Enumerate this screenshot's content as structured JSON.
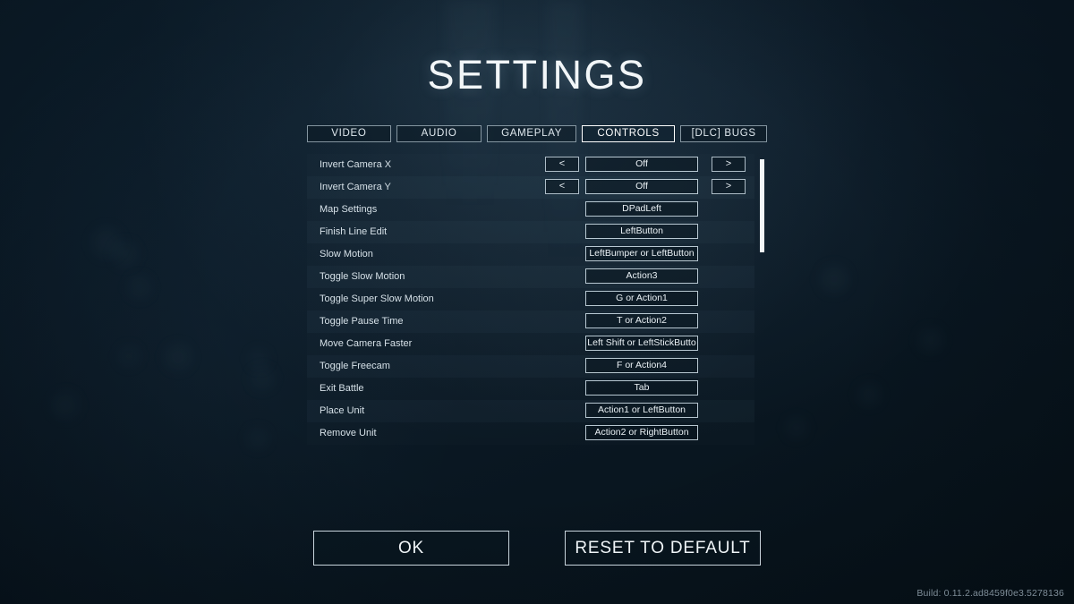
{
  "title": "SETTINGS",
  "tabs": [
    {
      "label": "VIDEO",
      "active": false
    },
    {
      "label": "AUDIO",
      "active": false
    },
    {
      "label": "GAMEPLAY",
      "active": false
    },
    {
      "label": "CONTROLS",
      "active": true
    },
    {
      "label": "[DLC] BUGS",
      "active": false
    }
  ],
  "settings": {
    "arrow_left_label": "<",
    "arrow_right_label": ">",
    "rows": [
      {
        "label": "Invert Camera X",
        "value": "Off",
        "arrows": true
      },
      {
        "label": "Invert Camera Y",
        "value": "Off",
        "arrows": true
      },
      {
        "label": "Map Settings",
        "value": "DPadLeft",
        "arrows": false
      },
      {
        "label": "Finish Line Edit",
        "value": "LeftButton",
        "arrows": false
      },
      {
        "label": "Slow Motion",
        "value": "LeftBumper or LeftButton",
        "arrows": false
      },
      {
        "label": "Toggle Slow Motion",
        "value": "Action3",
        "arrows": false
      },
      {
        "label": "Toggle Super Slow Motion",
        "value": "G or Action1",
        "arrows": false
      },
      {
        "label": "Toggle Pause Time",
        "value": "T or Action2",
        "arrows": false
      },
      {
        "label": "Move Camera Faster",
        "value": "Left Shift or LeftStickButto",
        "arrows": false
      },
      {
        "label": "Toggle Freecam",
        "value": "F or Action4",
        "arrows": false
      },
      {
        "label": "Exit Battle",
        "value": "Tab",
        "arrows": false
      },
      {
        "label": "Place Unit",
        "value": "Action1 or LeftButton",
        "arrows": false
      },
      {
        "label": "Remove Unit",
        "value": "Action2 or RightButton",
        "arrows": false
      }
    ]
  },
  "footer": {
    "ok_label": "OK",
    "reset_label": "RESET TO DEFAULT"
  },
  "build_version": "Build: 0.11.2.ad8459f0e3.5278136",
  "colors": {
    "background": "#0b1a26",
    "text": "#e7eef3",
    "border": "#dceaf2",
    "accent": "#ffffff"
  }
}
